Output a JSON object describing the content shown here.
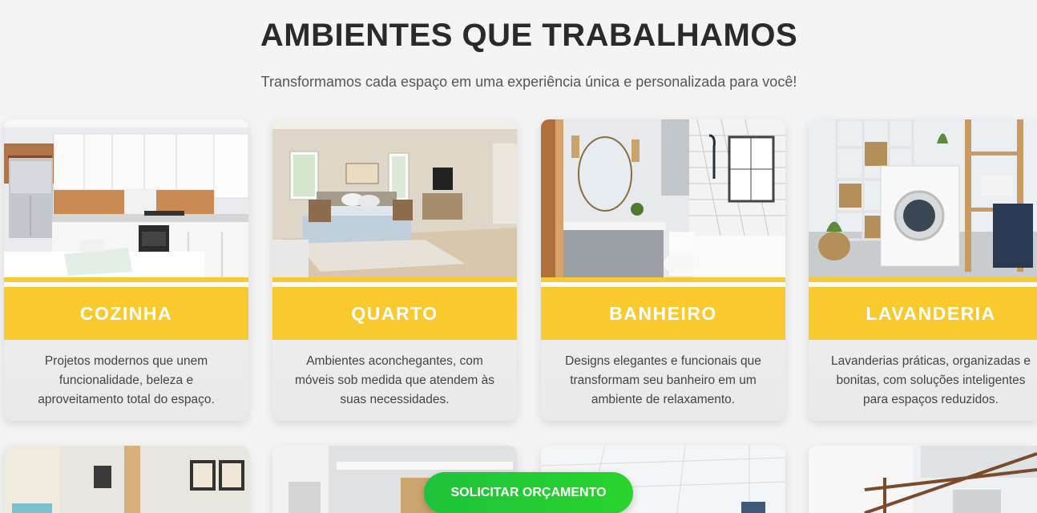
{
  "section": {
    "title": "AMBIENTES QUE TRABALHAMOS",
    "subtitle": "Transformamos cada espaço em uma experiência única e personalizada para você!"
  },
  "cards": [
    {
      "label": "COZINHA",
      "description": "Projetos modernos que unem funcionalidade, beleza e aproveitamento total do espaço.",
      "image": "kitchen-photo"
    },
    {
      "label": "QUARTO",
      "description": "Ambientes aconchegantes, com móveis sob medida que atendem às suas necessidades.",
      "image": "bedroom-photo"
    },
    {
      "label": "BANHEIRO",
      "description": "Designs elegantes e funcionais que transformam seu banheiro em um ambiente de relaxamento.",
      "image": "bathroom-photo"
    },
    {
      "label": "LAVANDERIA",
      "description": "Lavanderias práticas, organizadas e bonitas, com soluções inteligentes para espaços reduzidos.",
      "image": "laundry-photo"
    }
  ],
  "second_row_images": [
    "living-room-photo",
    "office-photo",
    "commercial-photo",
    "exterior-pergola-photo"
  ],
  "cta": {
    "label": "SOLICITAR ORÇAMENTO"
  },
  "colors": {
    "accent": "#f8ca30",
    "cta": "#22c935",
    "title": "#2a2a2a"
  }
}
